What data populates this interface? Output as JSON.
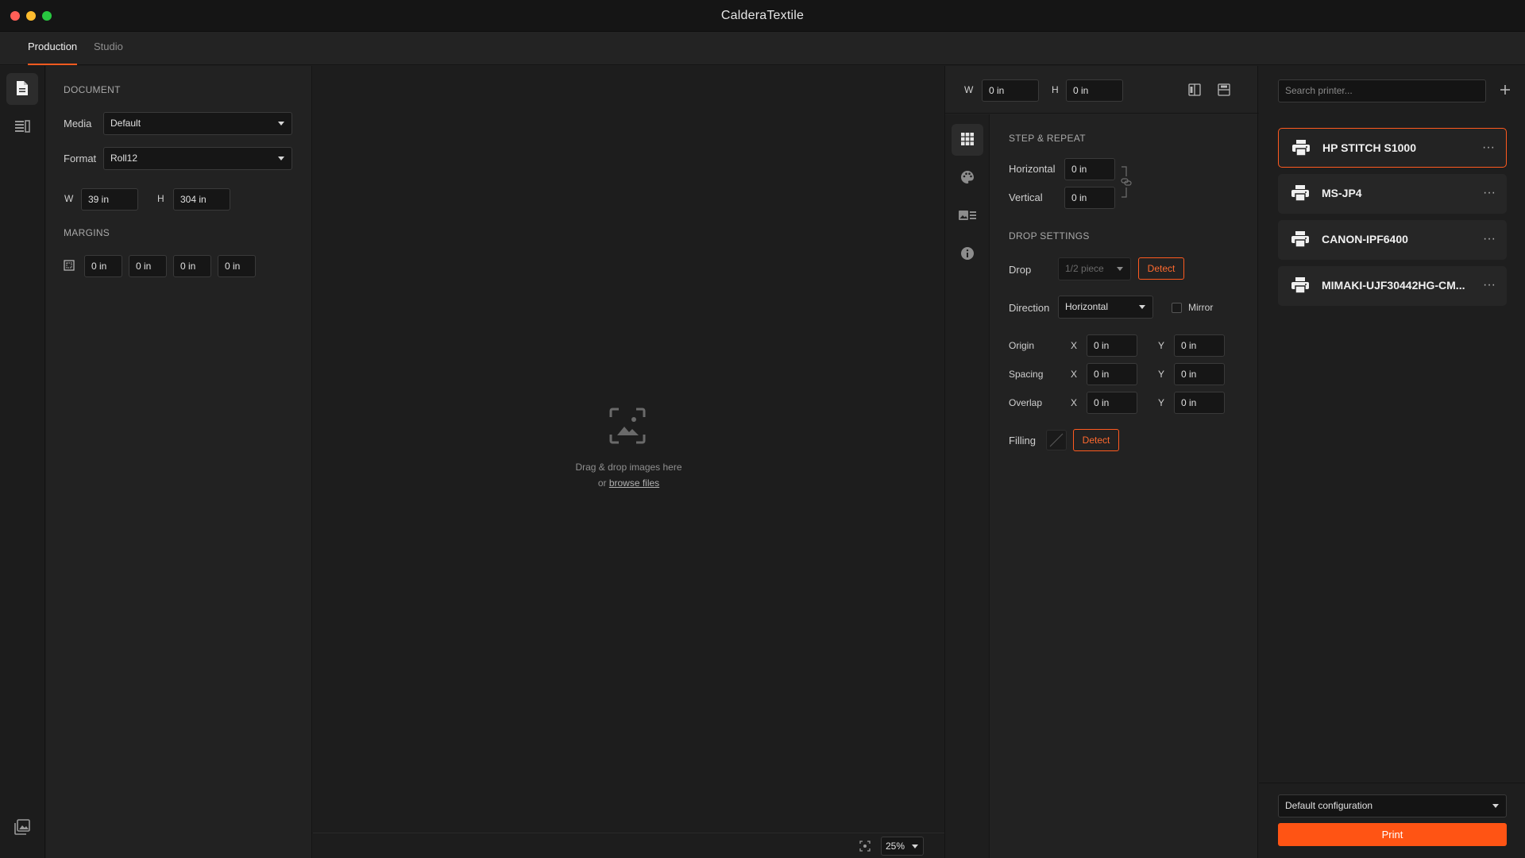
{
  "app": {
    "title": "CalderaTextile"
  },
  "tabs": [
    {
      "label": "Production",
      "active": true
    },
    {
      "label": "Studio",
      "active": false
    }
  ],
  "document": {
    "section_title": "DOCUMENT",
    "media_label": "Media",
    "media_value": "Default",
    "format_label": "Format",
    "format_value": "Roll12",
    "w_label": "W",
    "w_value": "39 in",
    "h_label": "H",
    "h_value": "304 in",
    "margins_title": "MARGINS",
    "margins": [
      "0 in",
      "0 in",
      "0 in",
      "0 in"
    ]
  },
  "canvas": {
    "drop_text": "Drag & drop images here",
    "or_text": "or",
    "browse_link": "browse files",
    "zoom": "25%"
  },
  "layout_panel": {
    "w_label": "W",
    "w_value": "0 in",
    "h_label": "H",
    "h_value": "0 in",
    "step_repeat_title": "STEP & REPEAT",
    "horizontal_label": "Horizontal",
    "horizontal_value": "0 in",
    "vertical_label": "Vertical",
    "vertical_value": "0 in",
    "drop_settings_title": "DROP SETTINGS",
    "drop_label": "Drop",
    "drop_value": "1/2 piece",
    "detect_label": "Detect",
    "direction_label": "Direction",
    "direction_value": "Horizontal",
    "mirror_label": "Mirror",
    "mirror_checked": false,
    "origin_label": "Origin",
    "spacing_label": "Spacing",
    "overlap_label": "Overlap",
    "x_label": "X",
    "y_label": "Y",
    "origin_x": "0 in",
    "origin_y": "0 in",
    "spacing_x": "0 in",
    "spacing_y": "0 in",
    "overlap_x": "0 in",
    "overlap_y": "0 in",
    "filling_label": "Filling",
    "filling_detect_label": "Detect"
  },
  "printers": {
    "search_placeholder": "Search printer...",
    "add_icon": "plus-icon",
    "items": [
      {
        "name": "HP STITCH S1000",
        "selected": true
      },
      {
        "name": "MS-JP4",
        "selected": false
      },
      {
        "name": "CANON-IPF6400",
        "selected": false
      },
      {
        "name": "MIMAKI-UJF30442HG-CM...",
        "selected": false
      }
    ],
    "more_label": "···",
    "configuration": "Default configuration",
    "print_label": "Print"
  },
  "colors": {
    "accent": "#ff5a1f",
    "background": "#1e1e1e",
    "panel": "#222222"
  }
}
